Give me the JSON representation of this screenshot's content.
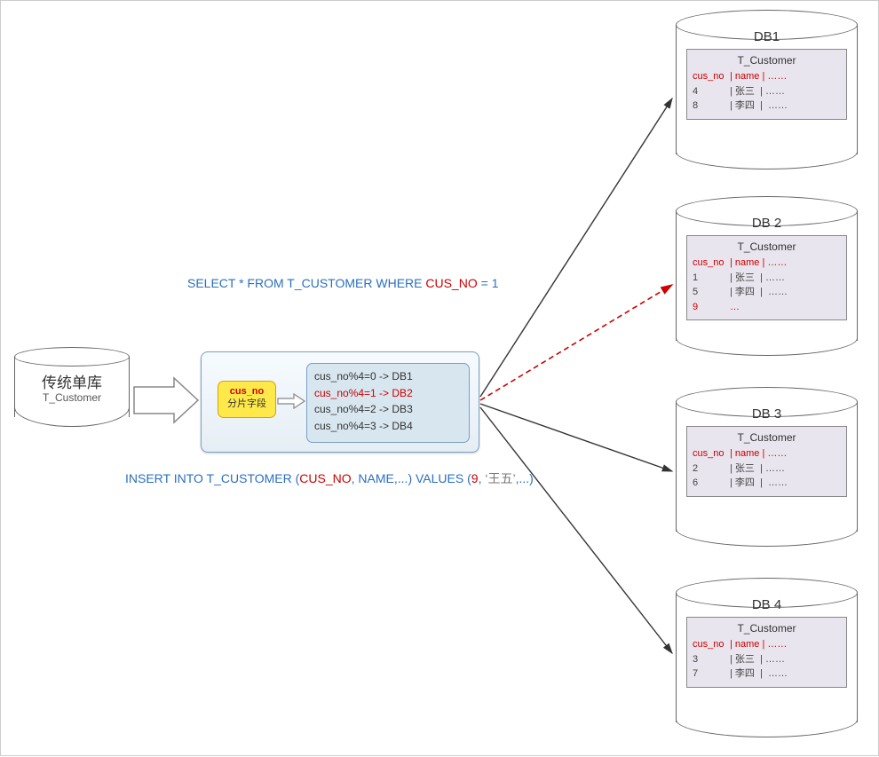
{
  "source_db": {
    "line1": "传统单库",
    "line2": "T_Customer"
  },
  "router": {
    "shard_key": "cus_no",
    "shard_key_sub": "分片字段",
    "rules": [
      {
        "text": "cus_no%4=0 -> DB1",
        "hl": false
      },
      {
        "text": "cus_no%4=1 -> DB2",
        "hl": true
      },
      {
        "text": "cus_no%4=2 -> DB3",
        "hl": false
      },
      {
        "text": "cus_no%4=3 -> DB4",
        "hl": false
      }
    ]
  },
  "sql_select": {
    "prefix": "SELECT * FROM T_CUSTOMER WHERE ",
    "key": "CUS_NO",
    "suffix": " = 1"
  },
  "sql_insert": {
    "p1": "INSERT INTO T_CUSTOMER (",
    "k1": "CUS_NO",
    "p2": ", NAME,...) VALUES (",
    "k2": "9",
    "p3": ",   ",
    "v1": "‘王五’",
    "p4": ",...)"
  },
  "table_name": "T_Customer",
  "header": {
    "c1": "cus_no",
    "c2": "| name",
    "c3": "| ……"
  },
  "targets": {
    "db1": {
      "title": "DB1",
      "rows": [
        {
          "k": "4",
          "n": "张三"
        },
        {
          "k": "8",
          "n": "李四"
        }
      ]
    },
    "db2": {
      "title": "DB 2",
      "rows": [
        {
          "k": "1",
          "n": "张三"
        },
        {
          "k": "5",
          "n": "李四"
        },
        {
          "k": "9",
          "n": "…",
          "short": true
        }
      ]
    },
    "db3": {
      "title": "DB 3",
      "rows": [
        {
          "k": "2",
          "n": "张三"
        },
        {
          "k": "6",
          "n": "李四"
        }
      ]
    },
    "db4": {
      "title": "DB 4",
      "rows": [
        {
          "k": "3",
          "n": "张三"
        },
        {
          "k": "7",
          "n": "李四"
        }
      ]
    }
  },
  "dots": "……"
}
